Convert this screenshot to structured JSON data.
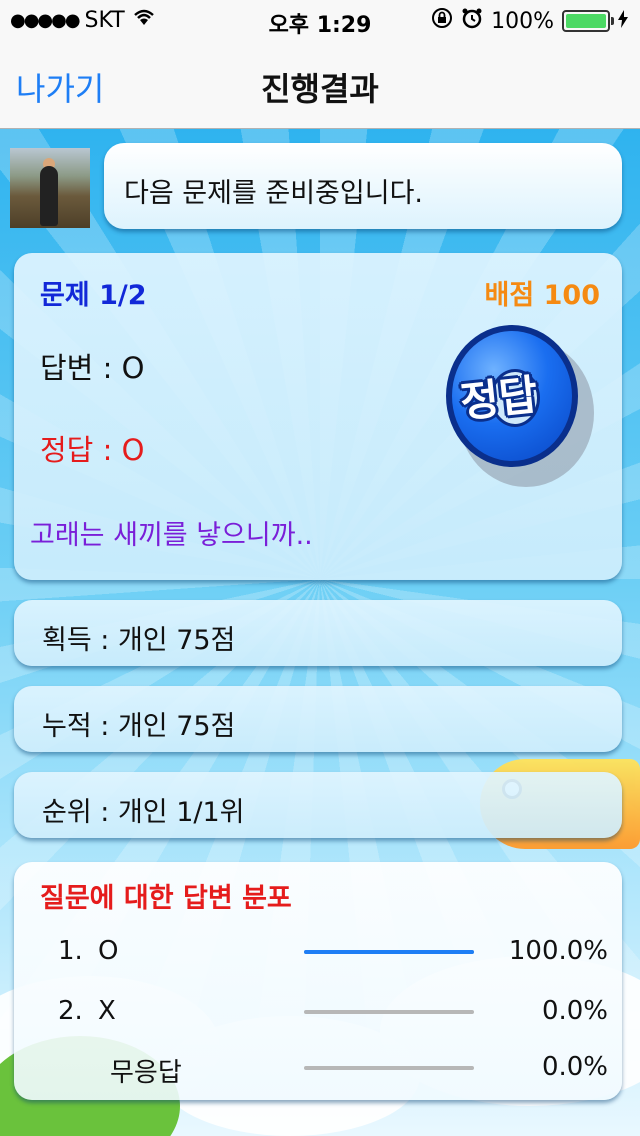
{
  "status_bar": {
    "carrier": "SKT",
    "time": "오후 1:29",
    "battery": "100%"
  },
  "nav": {
    "back_label": "나가기",
    "title": "진행결과"
  },
  "message": {
    "text": "다음 문제를 준비중입니다."
  },
  "question": {
    "number": "문제 1/2",
    "score": "배점 100",
    "answer": "답변 : O",
    "correct": "정답 : O",
    "badge": "정답",
    "explanation": "고래는 새끼를 낳으니까.."
  },
  "stats": {
    "earned": "획득 : 개인 75점",
    "total": "누적 : 개인 75점",
    "rank": "순위 : 개인 1/1위"
  },
  "distribution": {
    "title": "질문에 대한 답변 분포",
    "rows": [
      {
        "index": "1.",
        "label": "O",
        "percent_text": "100.0%",
        "fraction": 1.0
      },
      {
        "index": "2.",
        "label": "X",
        "percent_text": "0.0%",
        "fraction": 0.0
      },
      {
        "index": "",
        "label": "무응답",
        "percent_text": "0.0%",
        "fraction": 0.0
      }
    ]
  },
  "colors": {
    "accent_blue": "#1e7ef5",
    "question_blue": "#1228d8",
    "score_orange": "#f58a12",
    "correct_red": "#e51c1c",
    "explain_purple": "#7a1fd8"
  },
  "icons": [
    "wifi-icon",
    "lock-rotation-icon",
    "alarm-icon",
    "battery-icon",
    "charging-icon"
  ]
}
